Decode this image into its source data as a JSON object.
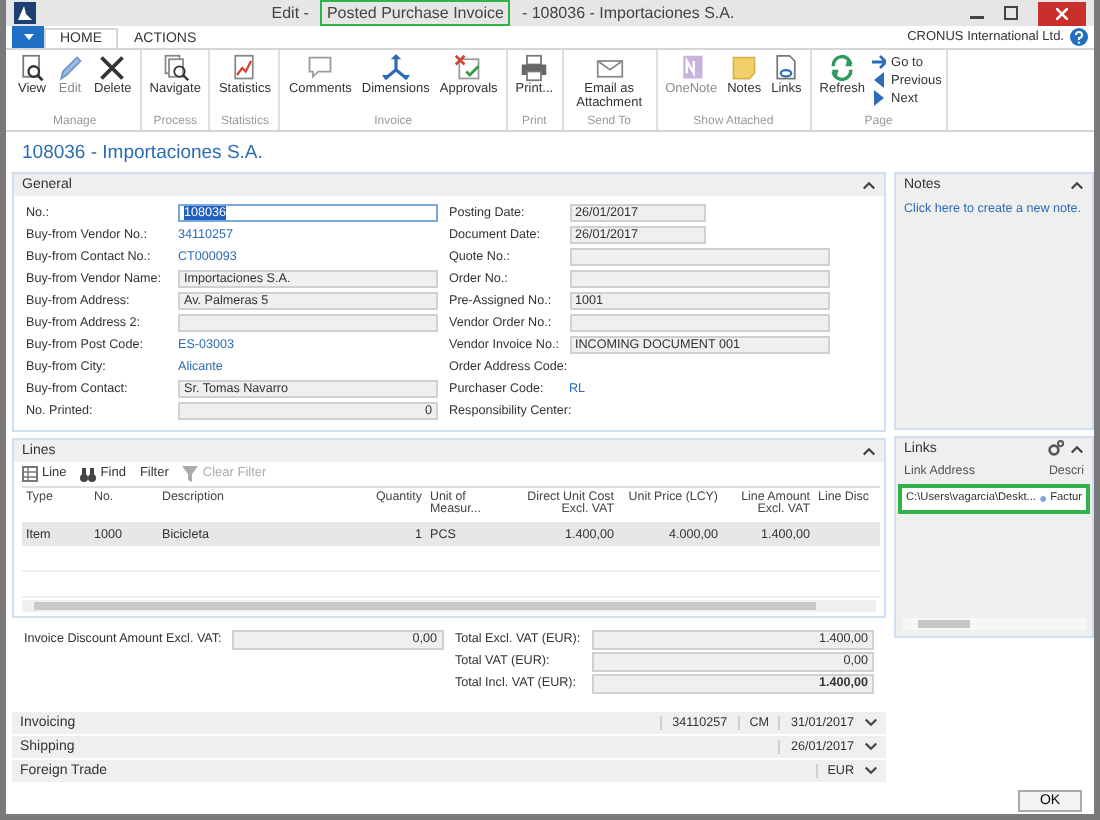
{
  "window": {
    "title_parts": [
      {
        "text": "Edit -",
        "highlighted": false
      },
      {
        "text": "Posted Purchase Invoice",
        "highlighted": true
      },
      {
        "text": "- 108036 - Importaciones S.A.",
        "highlighted": false
      }
    ]
  },
  "ribbon_tabs": [
    {
      "label": "HOME",
      "selected": true
    },
    {
      "label": "ACTIONS",
      "selected": false
    }
  ],
  "company": "CRONUS International Ltd.",
  "ribbon_groups": [
    {
      "label": "Manage",
      "buttons": [
        {
          "label": "View",
          "disabled": false
        },
        {
          "label": "Edit",
          "disabled": true
        },
        {
          "label": "Delete",
          "disabled": false
        }
      ]
    },
    {
      "label": "Process",
      "buttons": [
        {
          "label": "Navigate",
          "disabled": false
        }
      ]
    },
    {
      "label": "Statistics",
      "buttons": [
        {
          "label": "Statistics",
          "disabled": false
        }
      ]
    },
    {
      "label": "Invoice",
      "buttons": [
        {
          "label": "Comments",
          "disabled": false
        },
        {
          "label": "Dimensions",
          "disabled": false
        },
        {
          "label": "Approvals",
          "disabled": false
        }
      ]
    },
    {
      "label": "Print",
      "buttons": [
        {
          "label": "Print...",
          "disabled": false
        }
      ]
    },
    {
      "label": "Send To",
      "buttons": [
        {
          "label": "Email as Attachment",
          "disabled": false
        }
      ]
    },
    {
      "label": "Show Attached",
      "buttons": [
        {
          "label": "OneNote",
          "disabled": true
        },
        {
          "label": "Notes",
          "disabled": false
        },
        {
          "label": "Links",
          "disabled": false
        }
      ]
    },
    {
      "label": "Page",
      "buttons": [
        {
          "label": "Refresh",
          "disabled": false
        }
      ],
      "nav": [
        "Go to",
        "Previous",
        "Next"
      ]
    }
  ],
  "page_title": "108036 - Importaciones S.A.",
  "general": {
    "title": "General",
    "expanded": true,
    "left_fields": [
      {
        "label": "No.:",
        "value": "108036",
        "kind": "focused-input"
      },
      {
        "label": "Buy-from Vendor No.:",
        "value": "34110257",
        "kind": "link"
      },
      {
        "label": "Buy-from Contact No.:",
        "value": "CT000093",
        "kind": "link"
      },
      {
        "label": "Buy-from Vendor Name:",
        "value": "Importaciones S.A.",
        "kind": "input"
      },
      {
        "label": "Buy-from Address:",
        "value": "Av. Palmeras 5",
        "kind": "input"
      },
      {
        "label": "Buy-from Address 2:",
        "kind": "input"
      },
      {
        "label": "Buy-from Post Code:",
        "value": "ES-03003",
        "kind": "link"
      },
      {
        "label": "Buy-from City:",
        "value": "Alicante",
        "kind": "link"
      },
      {
        "label": "Buy-from Contact:",
        "value": "Sr. Tomas Navarro",
        "kind": "input"
      },
      {
        "label": "No. Printed:",
        "value": "0",
        "kind": "number-input"
      }
    ],
    "right_fields": [
      {
        "label": "Posting Date:",
        "value": "26/01/2017",
        "kind": "short-input"
      },
      {
        "label": "Document Date:",
        "value": "26/01/2017",
        "kind": "short-input"
      },
      {
        "label": "Quote No.:",
        "kind": "input"
      },
      {
        "label": "Order No.:",
        "kind": "input"
      },
      {
        "label": "Pre-Assigned No.:",
        "value": "1001",
        "kind": "input"
      },
      {
        "label": "Vendor Order No.:",
        "kind": "input"
      },
      {
        "label": "Vendor Invoice No.:",
        "value": "INCOMING DOCUMENT 001",
        "kind": "input"
      },
      {
        "label": "Order Address Code:",
        "kind": "text"
      },
      {
        "label": "Purchaser Code:",
        "value": "RL",
        "kind": "link"
      },
      {
        "label": "Responsibility Center:",
        "kind": "text"
      }
    ]
  },
  "lines": {
    "title": "Lines",
    "expanded": true,
    "toolbar": [
      {
        "label": "Line",
        "disabled": false
      },
      {
        "label": "Find",
        "disabled": false
      },
      {
        "label": "Filter",
        "disabled": false
      },
      {
        "label": "Clear Filter",
        "disabled": true
      }
    ],
    "columns": [
      "Type",
      "No.",
      "Description",
      "Quantity",
      "Unit of Measur...",
      "Direct Unit Cost Excl. VAT",
      "Unit Price (LCY)",
      "Line Amount Excl. VAT",
      "Line Disc"
    ],
    "rows": [
      {
        "cells": [
          "Item",
          "1000",
          "Bicicleta",
          "1",
          "PCS",
          "1.400,00",
          "4.000,00",
          "1.400,00"
        ],
        "selected": true
      }
    ]
  },
  "totals": {
    "discount": {
      "label": "Invoice Discount Amount Excl. VAT:",
      "value": "0,00"
    },
    "items": [
      {
        "label": "Total Excl. VAT (EUR):",
        "value": "1.400,00",
        "bold": false
      },
      {
        "label": "Total VAT (EUR):",
        "value": "0,00",
        "bold": false
      },
      {
        "label": "Total Incl. VAT (EUR):",
        "value": "1.400,00",
        "bold": true
      }
    ]
  },
  "fasttabs": [
    {
      "title": "Invoicing",
      "values": [
        "34110257",
        "CM",
        "31/01/2017"
      ],
      "expanded": false
    },
    {
      "title": "Shipping",
      "values": [
        "26/01/2017"
      ],
      "expanded": false
    },
    {
      "title": "Foreign Trade",
      "values": [
        "EUR"
      ],
      "expanded": false
    }
  ],
  "notes": {
    "title": "Notes",
    "link": "Click here to create a new note.",
    "expanded": true
  },
  "links": {
    "title": "Links",
    "expanded": true,
    "columns": [
      "Link Address",
      "Descri"
    ],
    "rows": [
      {
        "address": "C:\\Users\\vagarcia\\Deskt...",
        "description": "Factur",
        "highlighted": true
      }
    ]
  },
  "ok_button": "OK"
}
